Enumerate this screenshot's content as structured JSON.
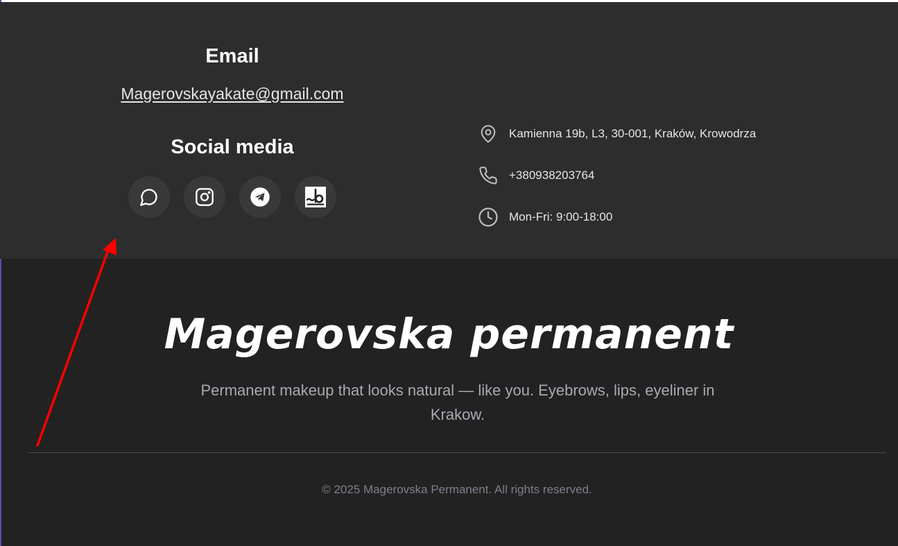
{
  "contact": {
    "email_heading": "Email",
    "email": "Magerovskayakate@gmail.com",
    "social_heading": "Social media",
    "social_icons": [
      "chat-icon",
      "instagram-icon",
      "telegram-icon",
      "booksy-icon"
    ],
    "address": "Kamienna 19b, L3, 30-001, Kraków, Krowodrza",
    "phone": "+380938203764",
    "hours": "Mon-Fri: 9:00-18:00"
  },
  "footer": {
    "brand": "Magerovska permanent",
    "tagline": "Permanent makeup that looks natural — like you. Eyebrows, lips, eyeliner in Krakow.",
    "copyright": "© 2025 Magerovska Permanent. All rights reserved."
  },
  "colors": {
    "contact_bg": "#2d2d2d",
    "footer_bg": "#222222",
    "annotation_arrow": "#ff0000"
  }
}
